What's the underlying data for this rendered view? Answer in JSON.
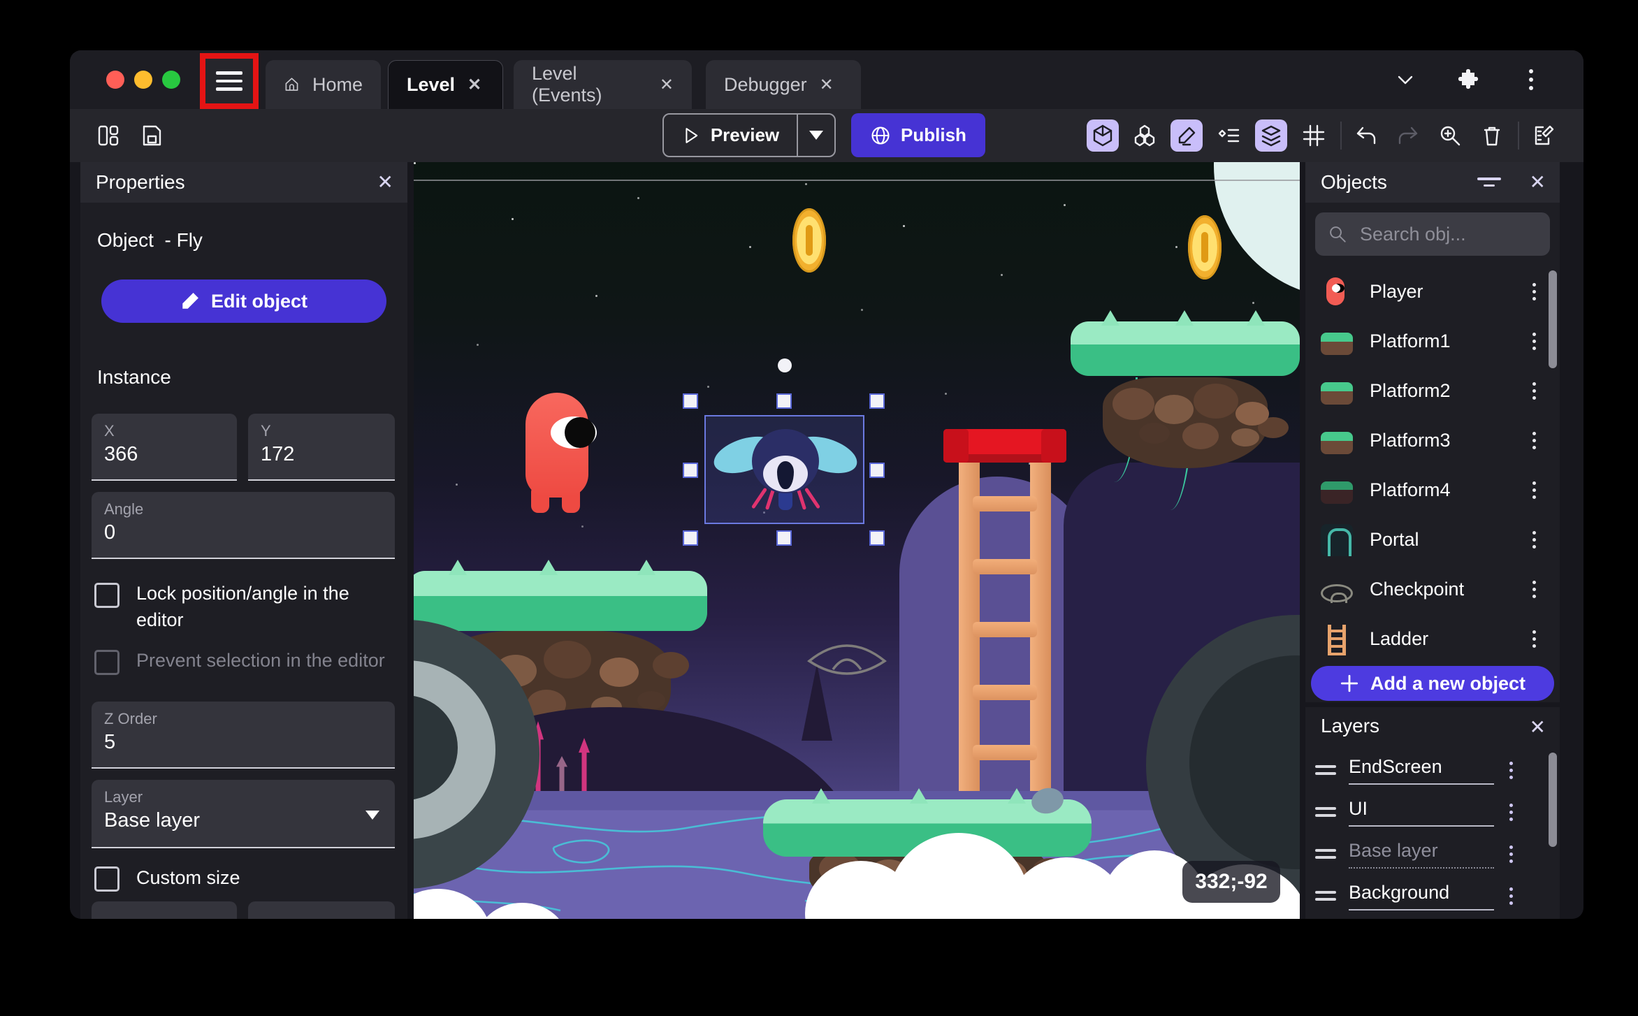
{
  "titlebar": {
    "tabs": [
      {
        "label": "Home"
      },
      {
        "label": "Level",
        "active": true
      },
      {
        "label": "Level (Events)"
      },
      {
        "label": "Debugger"
      }
    ],
    "close_symbol": "✕"
  },
  "toolbar": {
    "preview_label": "Preview",
    "publish_label": "Publish"
  },
  "properties_panel": {
    "title": "Properties",
    "close_symbol": "✕",
    "object_heading": "Object  - Fly",
    "edit_object_label": "Edit object",
    "instance_heading": "Instance",
    "x_label": "X",
    "x_value": "366",
    "y_label": "Y",
    "y_value": "172",
    "angle_label": "Angle",
    "angle_value": "0",
    "lock_label": "Lock position/angle in the editor",
    "prevent_label": "Prevent selection in the editor",
    "zorder_label": "Z Order",
    "zorder_value": "5",
    "layer_label": "Layer",
    "layer_value": "Base layer",
    "custom_size_label": "Custom size"
  },
  "canvas": {
    "coords_badge": "332;-92"
  },
  "objects_panel": {
    "title": "Objects",
    "close_symbol": "✕",
    "search_placeholder": "Search obj...",
    "items": [
      {
        "name": "Player"
      },
      {
        "name": "Platform1"
      },
      {
        "name": "Platform2"
      },
      {
        "name": "Platform3"
      },
      {
        "name": "Platform4"
      },
      {
        "name": "Portal"
      },
      {
        "name": "Checkpoint"
      },
      {
        "name": "Ladder"
      }
    ],
    "add_button_label": "Add a new object"
  },
  "layers_panel": {
    "title": "Layers",
    "close_symbol": "✕",
    "layers": [
      {
        "name": "EndScreen"
      },
      {
        "name": "UI"
      },
      {
        "name": "Base layer",
        "dimmed": true
      },
      {
        "name": "Background"
      }
    ]
  },
  "colors": {
    "accent_purple": "#4633d4",
    "annotation_red": "#e41414",
    "selection_blue": "#6b79e0"
  }
}
